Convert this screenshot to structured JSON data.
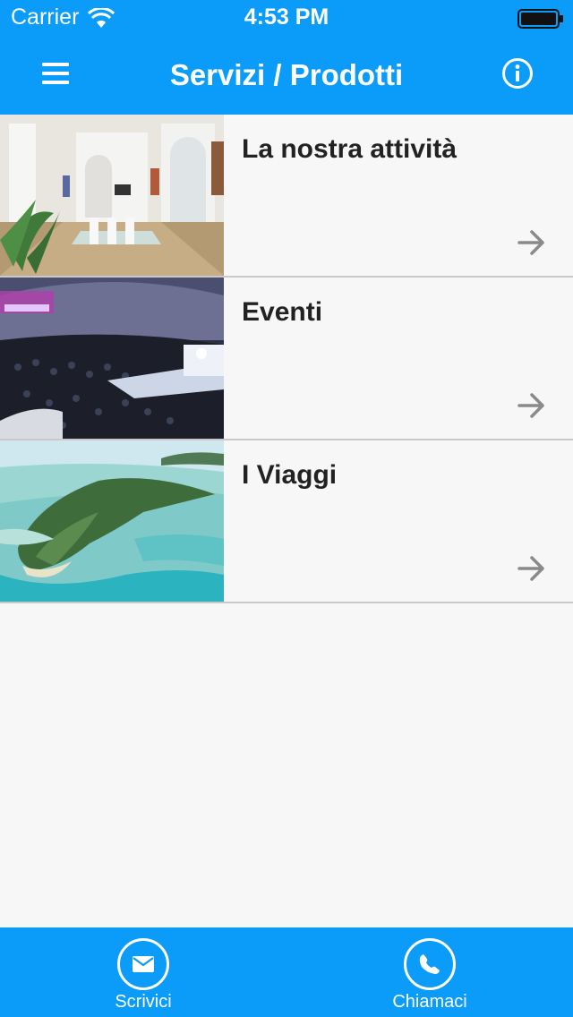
{
  "status_bar": {
    "carrier": "Carrier",
    "time": "4:53 PM"
  },
  "nav": {
    "title": "Servizi / Prodotti",
    "left_icon": "hamburger-menu-icon",
    "right_icon": "info-icon"
  },
  "list": {
    "items": [
      {
        "title": "La nostra attività",
        "image": "office-meeting-room-photo",
        "icon": "arrow-right-icon"
      },
      {
        "title": "Eventi",
        "image": "concert-crowd-photo",
        "icon": "arrow-right-icon"
      },
      {
        "title": "I Viaggi",
        "image": "tropical-island-aerial-photo",
        "icon": "arrow-right-icon"
      }
    ]
  },
  "tab_bar": {
    "write_label": "Scrivici",
    "call_label": "Chiamaci",
    "write_icon": "envelope-icon",
    "call_icon": "phone-icon"
  },
  "colors": {
    "accent": "#0a9cf8",
    "background": "#f7f7f7",
    "divider": "#c9c9c9",
    "text": "#222222",
    "arrow": "#8a8a8a"
  }
}
